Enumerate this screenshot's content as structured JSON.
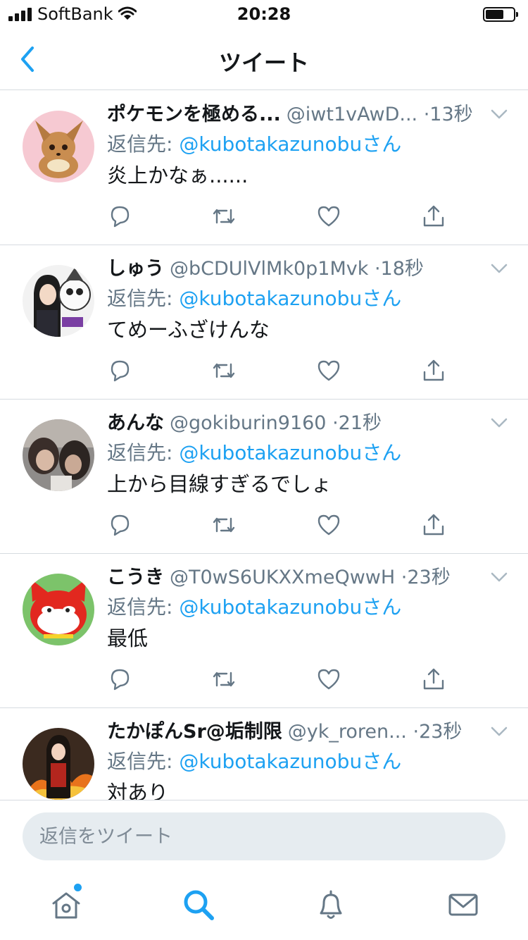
{
  "status_bar": {
    "carrier": "SoftBank",
    "time": "20:28"
  },
  "nav": {
    "title": "ツイート"
  },
  "tweets": [
    {
      "name": "ポケモンを極める...",
      "handle": "@iwt1vAwD...",
      "time": "·13秒",
      "reply_label": "返信先:",
      "reply_to": "@kubotakazunobuさん",
      "text": "炎上かなぁ......",
      "avatar": "eevee-avatar"
    },
    {
      "name": "しゅう",
      "handle": "@bCDUlVlMk0p1Mvk",
      "time": "·18秒",
      "reply_label": "返信先:",
      "reply_to": "@kubotakazunobuさん",
      "text": "てめーふざけんな",
      "avatar": "anime-girl-avatar"
    },
    {
      "name": "あんな",
      "handle": "@gokiburin9160",
      "time": "·21秒",
      "reply_label": "返信先:",
      "reply_to": "@kubotakazunobuさん",
      "text": "上から目線すぎるでしょ",
      "avatar": "photo-avatar"
    },
    {
      "name": "こうき",
      "handle": "@T0wS6UKXXmeQwwH",
      "time": "·23秒",
      "reply_label": "返信先:",
      "reply_to": "@kubotakazunobuさん",
      "text": "最低",
      "avatar": "jibanyan-avatar"
    },
    {
      "name": "たかぽんSr@垢制限",
      "handle": "@yk_roren...",
      "time": "·23秒",
      "reply_label": "返信先:",
      "reply_to": "@kubotakazunobuさん",
      "text": "対あり",
      "avatar": "fire-warrior-avatar"
    }
  ],
  "composer": {
    "placeholder": "返信をツイート"
  },
  "tabs": [
    {
      "id": "home",
      "icon": "home-icon"
    },
    {
      "id": "search",
      "icon": "search-icon"
    },
    {
      "id": "notifications",
      "icon": "bell-icon"
    },
    {
      "id": "messages",
      "icon": "envelope-icon"
    }
  ],
  "colors": {
    "accent": "#1da1f2",
    "secondary_text": "#657786",
    "divider": "#d6dbe0",
    "composer_bg": "#e6ecf0"
  }
}
